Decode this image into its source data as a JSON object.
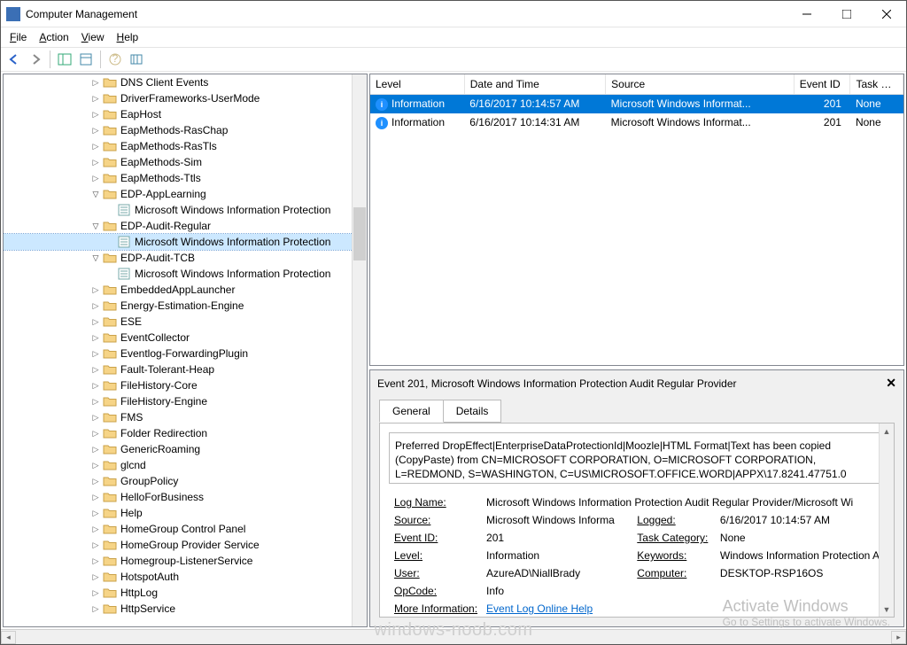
{
  "window": {
    "title": "Computer Management"
  },
  "menu": {
    "file": "File",
    "action": "Action",
    "view": "View",
    "help": "Help"
  },
  "tree": [
    {
      "indent": 6,
      "expand": "closed",
      "icon": "folder",
      "label": "DNS Client Events"
    },
    {
      "indent": 6,
      "expand": "closed",
      "icon": "folder",
      "label": "DriverFrameworks-UserMode"
    },
    {
      "indent": 6,
      "expand": "closed",
      "icon": "folder",
      "label": "EapHost"
    },
    {
      "indent": 6,
      "expand": "closed",
      "icon": "folder",
      "label": "EapMethods-RasChap"
    },
    {
      "indent": 6,
      "expand": "closed",
      "icon": "folder",
      "label": "EapMethods-RasTls"
    },
    {
      "indent": 6,
      "expand": "closed",
      "icon": "folder",
      "label": "EapMethods-Sim"
    },
    {
      "indent": 6,
      "expand": "closed",
      "icon": "folder",
      "label": "EapMethods-Ttls"
    },
    {
      "indent": 6,
      "expand": "open",
      "icon": "folder",
      "label": "EDP-AppLearning"
    },
    {
      "indent": 7,
      "expand": "none",
      "icon": "log",
      "label": "Microsoft Windows Information Protection"
    },
    {
      "indent": 6,
      "expand": "open",
      "icon": "folder",
      "label": "EDP-Audit-Regular"
    },
    {
      "indent": 7,
      "expand": "none",
      "icon": "log",
      "label": "Microsoft Windows Information Protection",
      "selected": true
    },
    {
      "indent": 6,
      "expand": "open",
      "icon": "folder",
      "label": "EDP-Audit-TCB"
    },
    {
      "indent": 7,
      "expand": "none",
      "icon": "log",
      "label": "Microsoft Windows Information Protection"
    },
    {
      "indent": 6,
      "expand": "closed",
      "icon": "folder",
      "label": "EmbeddedAppLauncher"
    },
    {
      "indent": 6,
      "expand": "closed",
      "icon": "folder",
      "label": "Energy-Estimation-Engine"
    },
    {
      "indent": 6,
      "expand": "closed",
      "icon": "folder",
      "label": "ESE"
    },
    {
      "indent": 6,
      "expand": "closed",
      "icon": "folder",
      "label": "EventCollector"
    },
    {
      "indent": 6,
      "expand": "closed",
      "icon": "folder",
      "label": "Eventlog-ForwardingPlugin"
    },
    {
      "indent": 6,
      "expand": "closed",
      "icon": "folder",
      "label": "Fault-Tolerant-Heap"
    },
    {
      "indent": 6,
      "expand": "closed",
      "icon": "folder",
      "label": "FileHistory-Core"
    },
    {
      "indent": 6,
      "expand": "closed",
      "icon": "folder",
      "label": "FileHistory-Engine"
    },
    {
      "indent": 6,
      "expand": "closed",
      "icon": "folder",
      "label": "FMS"
    },
    {
      "indent": 6,
      "expand": "closed",
      "icon": "folder",
      "label": "Folder Redirection"
    },
    {
      "indent": 6,
      "expand": "closed",
      "icon": "folder",
      "label": "GenericRoaming"
    },
    {
      "indent": 6,
      "expand": "closed",
      "icon": "folder",
      "label": "glcnd"
    },
    {
      "indent": 6,
      "expand": "closed",
      "icon": "folder",
      "label": "GroupPolicy"
    },
    {
      "indent": 6,
      "expand": "closed",
      "icon": "folder",
      "label": "HelloForBusiness"
    },
    {
      "indent": 6,
      "expand": "closed",
      "icon": "folder",
      "label": "Help"
    },
    {
      "indent": 6,
      "expand": "closed",
      "icon": "folder",
      "label": "HomeGroup Control Panel"
    },
    {
      "indent": 6,
      "expand": "closed",
      "icon": "folder",
      "label": "HomeGroup Provider Service"
    },
    {
      "indent": 6,
      "expand": "closed",
      "icon": "folder",
      "label": "Homegroup-ListenerService"
    },
    {
      "indent": 6,
      "expand": "closed",
      "icon": "folder",
      "label": "HotspotAuth"
    },
    {
      "indent": 6,
      "expand": "closed",
      "icon": "folder",
      "label": "HttpLog"
    },
    {
      "indent": 6,
      "expand": "closed",
      "icon": "folder",
      "label": "HttpService"
    }
  ],
  "grid": {
    "cols": {
      "level": "Level",
      "datetime": "Date and Time",
      "source": "Source",
      "eventid": "Event ID",
      "taskcat": "Task C..."
    },
    "rows": [
      {
        "level": "Information",
        "datetime": "6/16/2017 10:14:57 AM",
        "source": "Microsoft Windows Informat...",
        "eventid": "201",
        "taskcat": "None",
        "selected": true
      },
      {
        "level": "Information",
        "datetime": "6/16/2017 10:14:31 AM",
        "source": "Microsoft Windows Informat...",
        "eventid": "201",
        "taskcat": "None",
        "selected": false
      }
    ]
  },
  "detail": {
    "header": "Event 201, Microsoft Windows Information Protection Audit Regular Provider",
    "tabs": {
      "general": "General",
      "details": "Details"
    },
    "message": "Preferred DropEffect|EnterpriseDataProtectionId|Moozle|HTML Format|Text has been copied (CopyPaste) from CN=MICROSOFT CORPORATION, O=MICROSOFT CORPORATION, L=REDMOND, S=WASHINGTON, C=US\\MICROSOFT.OFFICE.WORD|APPX\\17.8241.47751.0",
    "labels": {
      "logname": "Log Name:",
      "source": "Source:",
      "eventid": "Event ID:",
      "level": "Level:",
      "user": "User:",
      "opcode": "OpCode:",
      "moreinfo": "More Information:",
      "logged": "Logged:",
      "taskcat": "Task Category:",
      "keywords": "Keywords:",
      "computer": "Computer:"
    },
    "values": {
      "logname": "Microsoft Windows Information Protection Audit Regular Provider/Microsoft Wi",
      "source": "Microsoft Windows Informa",
      "eventid": "201",
      "level": "Information",
      "user": "AzureAD\\NiallBrady",
      "opcode": "Info",
      "moreinfo": "Event Log Online Help",
      "logged": "6/16/2017 10:14:57 AM",
      "taskcat": "None",
      "keywords": "Windows Information Protection A",
      "computer": "DESKTOP-RSP16OS"
    }
  },
  "watermark": {
    "line1": "Activate Windows",
    "line2": "Go to Settings to activate Windows.",
    "center": "windows-noob.com"
  }
}
